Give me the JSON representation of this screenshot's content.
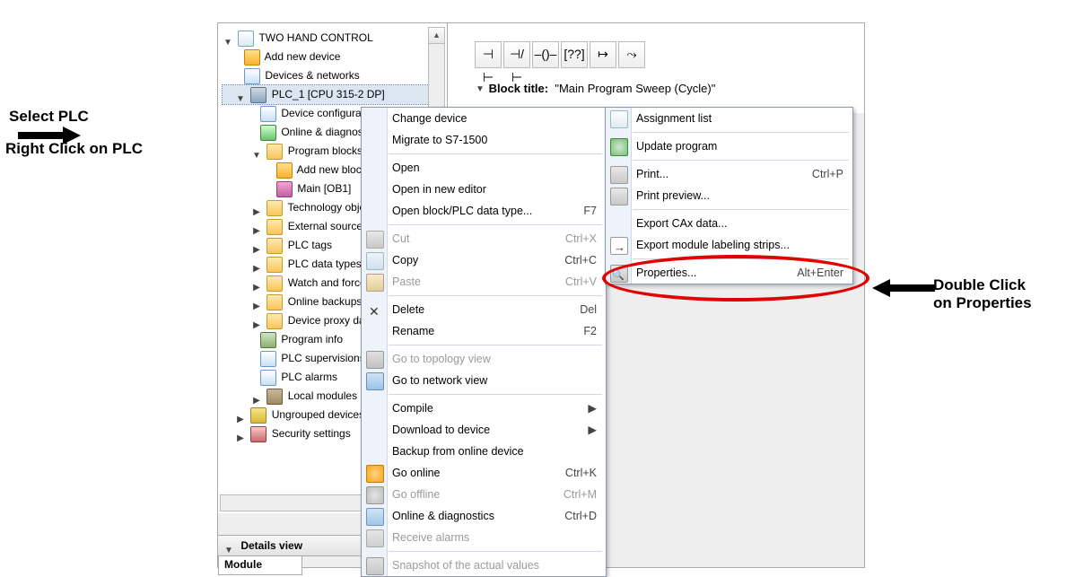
{
  "annotations": {
    "select": "Select PLC",
    "rightclick": "Right Click on PLC",
    "dblclick": "Double Click\non Properties"
  },
  "tree": {
    "root": "TWO HAND CONTROL",
    "add_device": "Add new device",
    "devices_networks": "Devices & networks",
    "plc": "PLC_1 [CPU 315-2 DP]",
    "device_config": "Device configuration",
    "online_diag": "Online & diagnostics",
    "program_blocks": "Program blocks",
    "add_block": "Add new block",
    "main_block": "Main [OB1]",
    "tech": "Technology objects",
    "ext_src": "External source files",
    "plc_tags": "PLC tags",
    "plc_datatypes": "PLC data types",
    "watch": "Watch and force tables",
    "online_backups": "Online backups",
    "device_proxy": "Device proxy data",
    "prog_info": "Program info",
    "plc_supervisions": "PLC supervisions",
    "plc_alarms": "PLC alarms",
    "local_modules": "Local modules",
    "ungrouped": "Ungrouped devices",
    "security": "Security settings"
  },
  "details": {
    "header": "Details view",
    "module": "Module"
  },
  "editor": {
    "block_title_label": "Block title:",
    "block_title_value": "\"Main Program Sweep (Cycle)\"",
    "tb": {
      "a": "⊣ ⊢",
      "b": "⊣/⊢",
      "c": "–()–",
      "d": "[??]",
      "e": "↦",
      "f": "⤳"
    }
  },
  "menu1": {
    "change_device": "Change device",
    "migrate": "Migrate to S7-1500",
    "open": "Open",
    "open_new": "Open in new editor",
    "open_block": "Open block/PLC data type...",
    "open_block_sc": "F7",
    "cut": "Cut",
    "cut_sc": "Ctrl+X",
    "copy": "Copy",
    "copy_sc": "Ctrl+C",
    "paste": "Paste",
    "paste_sc": "Ctrl+V",
    "delete": "Delete",
    "delete_sc": "Del",
    "rename": "Rename",
    "rename_sc": "F2",
    "topology": "Go to topology view",
    "network": "Go to network view",
    "compile": "Compile",
    "download": "Download to device",
    "backup": "Backup from online device",
    "go_online": "Go online",
    "go_online_sc": "Ctrl+K",
    "go_offline": "Go offline",
    "go_offline_sc": "Ctrl+M",
    "online_diag": "Online & diagnostics",
    "online_diag_sc": "Ctrl+D",
    "receive_alarms": "Receive alarms",
    "snapshot": "Snapshot of the actual values"
  },
  "menu2": {
    "assignment": "Assignment list",
    "update": "Update program",
    "print": "Print...",
    "print_sc": "Ctrl+P",
    "print_preview": "Print preview...",
    "export_cax": "Export CAx data...",
    "export_labels": "Export module labeling strips...",
    "properties": "Properties...",
    "properties_sc": "Alt+Enter"
  }
}
